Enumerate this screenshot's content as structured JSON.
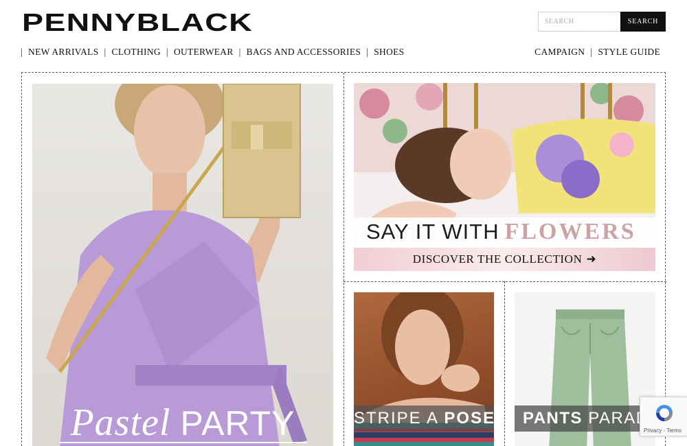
{
  "brand": {
    "name": "PENNYBLACK"
  },
  "search": {
    "placeholder": "SEARCH",
    "button_label": "SEARCH"
  },
  "nav_left": [
    "NEW ARRIVALS",
    "CLOTHING",
    "OUTERWEAR",
    "BAGS AND ACCESSORIES",
    "SHOES"
  ],
  "nav_right": [
    "CAMPAIGN",
    "STYLE GUIDE"
  ],
  "tiles": {
    "pastel": {
      "word1": "Pastel",
      "word2": "PARTY"
    },
    "flowers": {
      "word1": "SAY IT WITH",
      "word2": "FLOWERS",
      "cta": "DISCOVER THE COLLECTION"
    },
    "stripe": {
      "word1": "STRIPE A",
      "word2": "POSE"
    },
    "pants": {
      "word1": "PANTS",
      "word2": "PARADE"
    }
  },
  "recaptcha": {
    "terms": "Privacy - Terms"
  },
  "colors": {
    "accent": "#111111",
    "flowers_pink": "#c9a3a5",
    "dress_lilac": "#b79ad6",
    "pants_green": "#9fbf9c"
  },
  "icons": {
    "arrow": "arrow-right-icon",
    "recaptcha": "recaptcha-icon"
  }
}
